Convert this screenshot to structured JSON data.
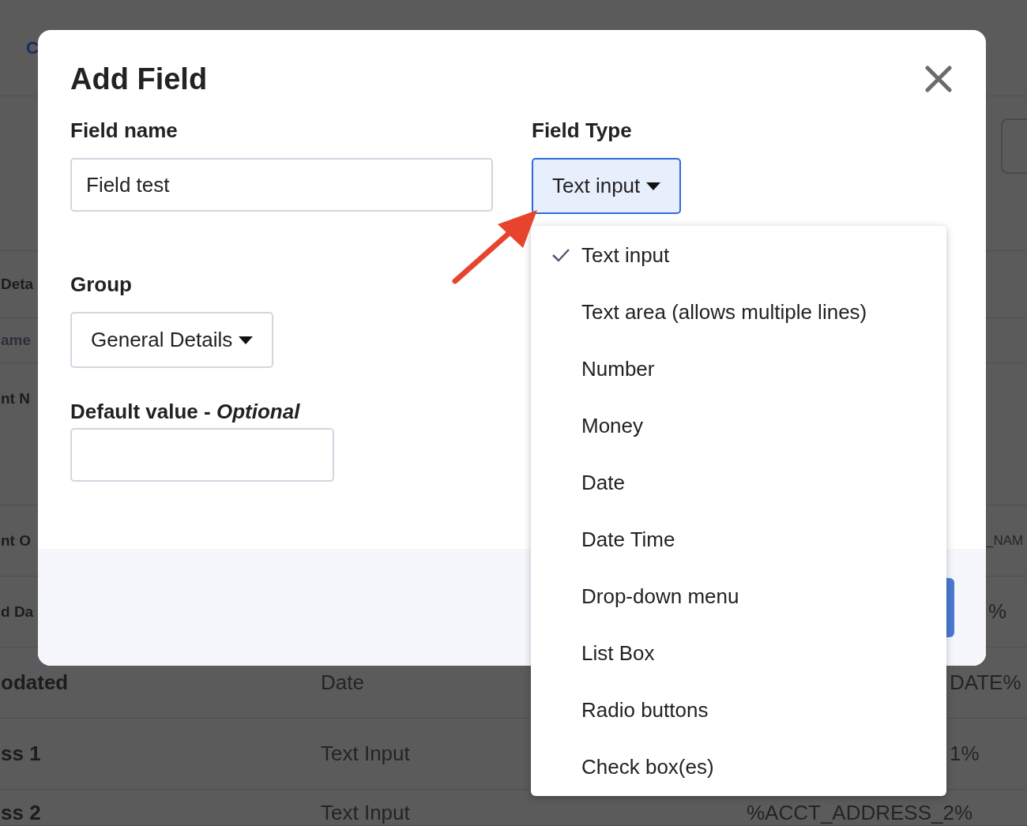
{
  "background": {
    "header_link": "C",
    "section_title": "Deta",
    "column_header": "ame",
    "rows": [
      {
        "column_1": "nt N"
      },
      {
        "column_1": "nt O",
        "column_3": "_NAM"
      },
      {
        "column_1": "d Da",
        "column_3": "%"
      },
      {
        "column_1": "odated",
        "column_2": "Date",
        "column_3": "DATE%"
      },
      {
        "column_1": "ss 1",
        "column_2": "Text Input",
        "column_3": "1%"
      },
      {
        "column_1": "ss 2",
        "column_2": "Text Input",
        "column_3": "%ACCT_ADDRESS_2%"
      }
    ]
  },
  "dialog": {
    "title": "Add Field",
    "field_name": {
      "label": "Field name",
      "value": "Field test"
    },
    "field_type": {
      "label": "Field Type",
      "value": "Text input",
      "expanded": true,
      "options": [
        {
          "label": "Text input",
          "selected": true
        },
        {
          "label": "Text area (allows multiple lines)",
          "selected": false
        },
        {
          "label": "Number",
          "selected": false
        },
        {
          "label": "Money",
          "selected": false
        },
        {
          "label": "Date",
          "selected": false
        },
        {
          "label": "Date Time",
          "selected": false
        },
        {
          "label": "Drop-down menu",
          "selected": false
        },
        {
          "label": "List Box",
          "selected": false
        },
        {
          "label": "Radio buttons",
          "selected": false
        },
        {
          "label": "Check box(es)",
          "selected": false
        }
      ]
    },
    "group": {
      "label": "Group",
      "value": "General Details"
    },
    "default_value": {
      "label": "Default value - *Optional*"
    }
  }
}
